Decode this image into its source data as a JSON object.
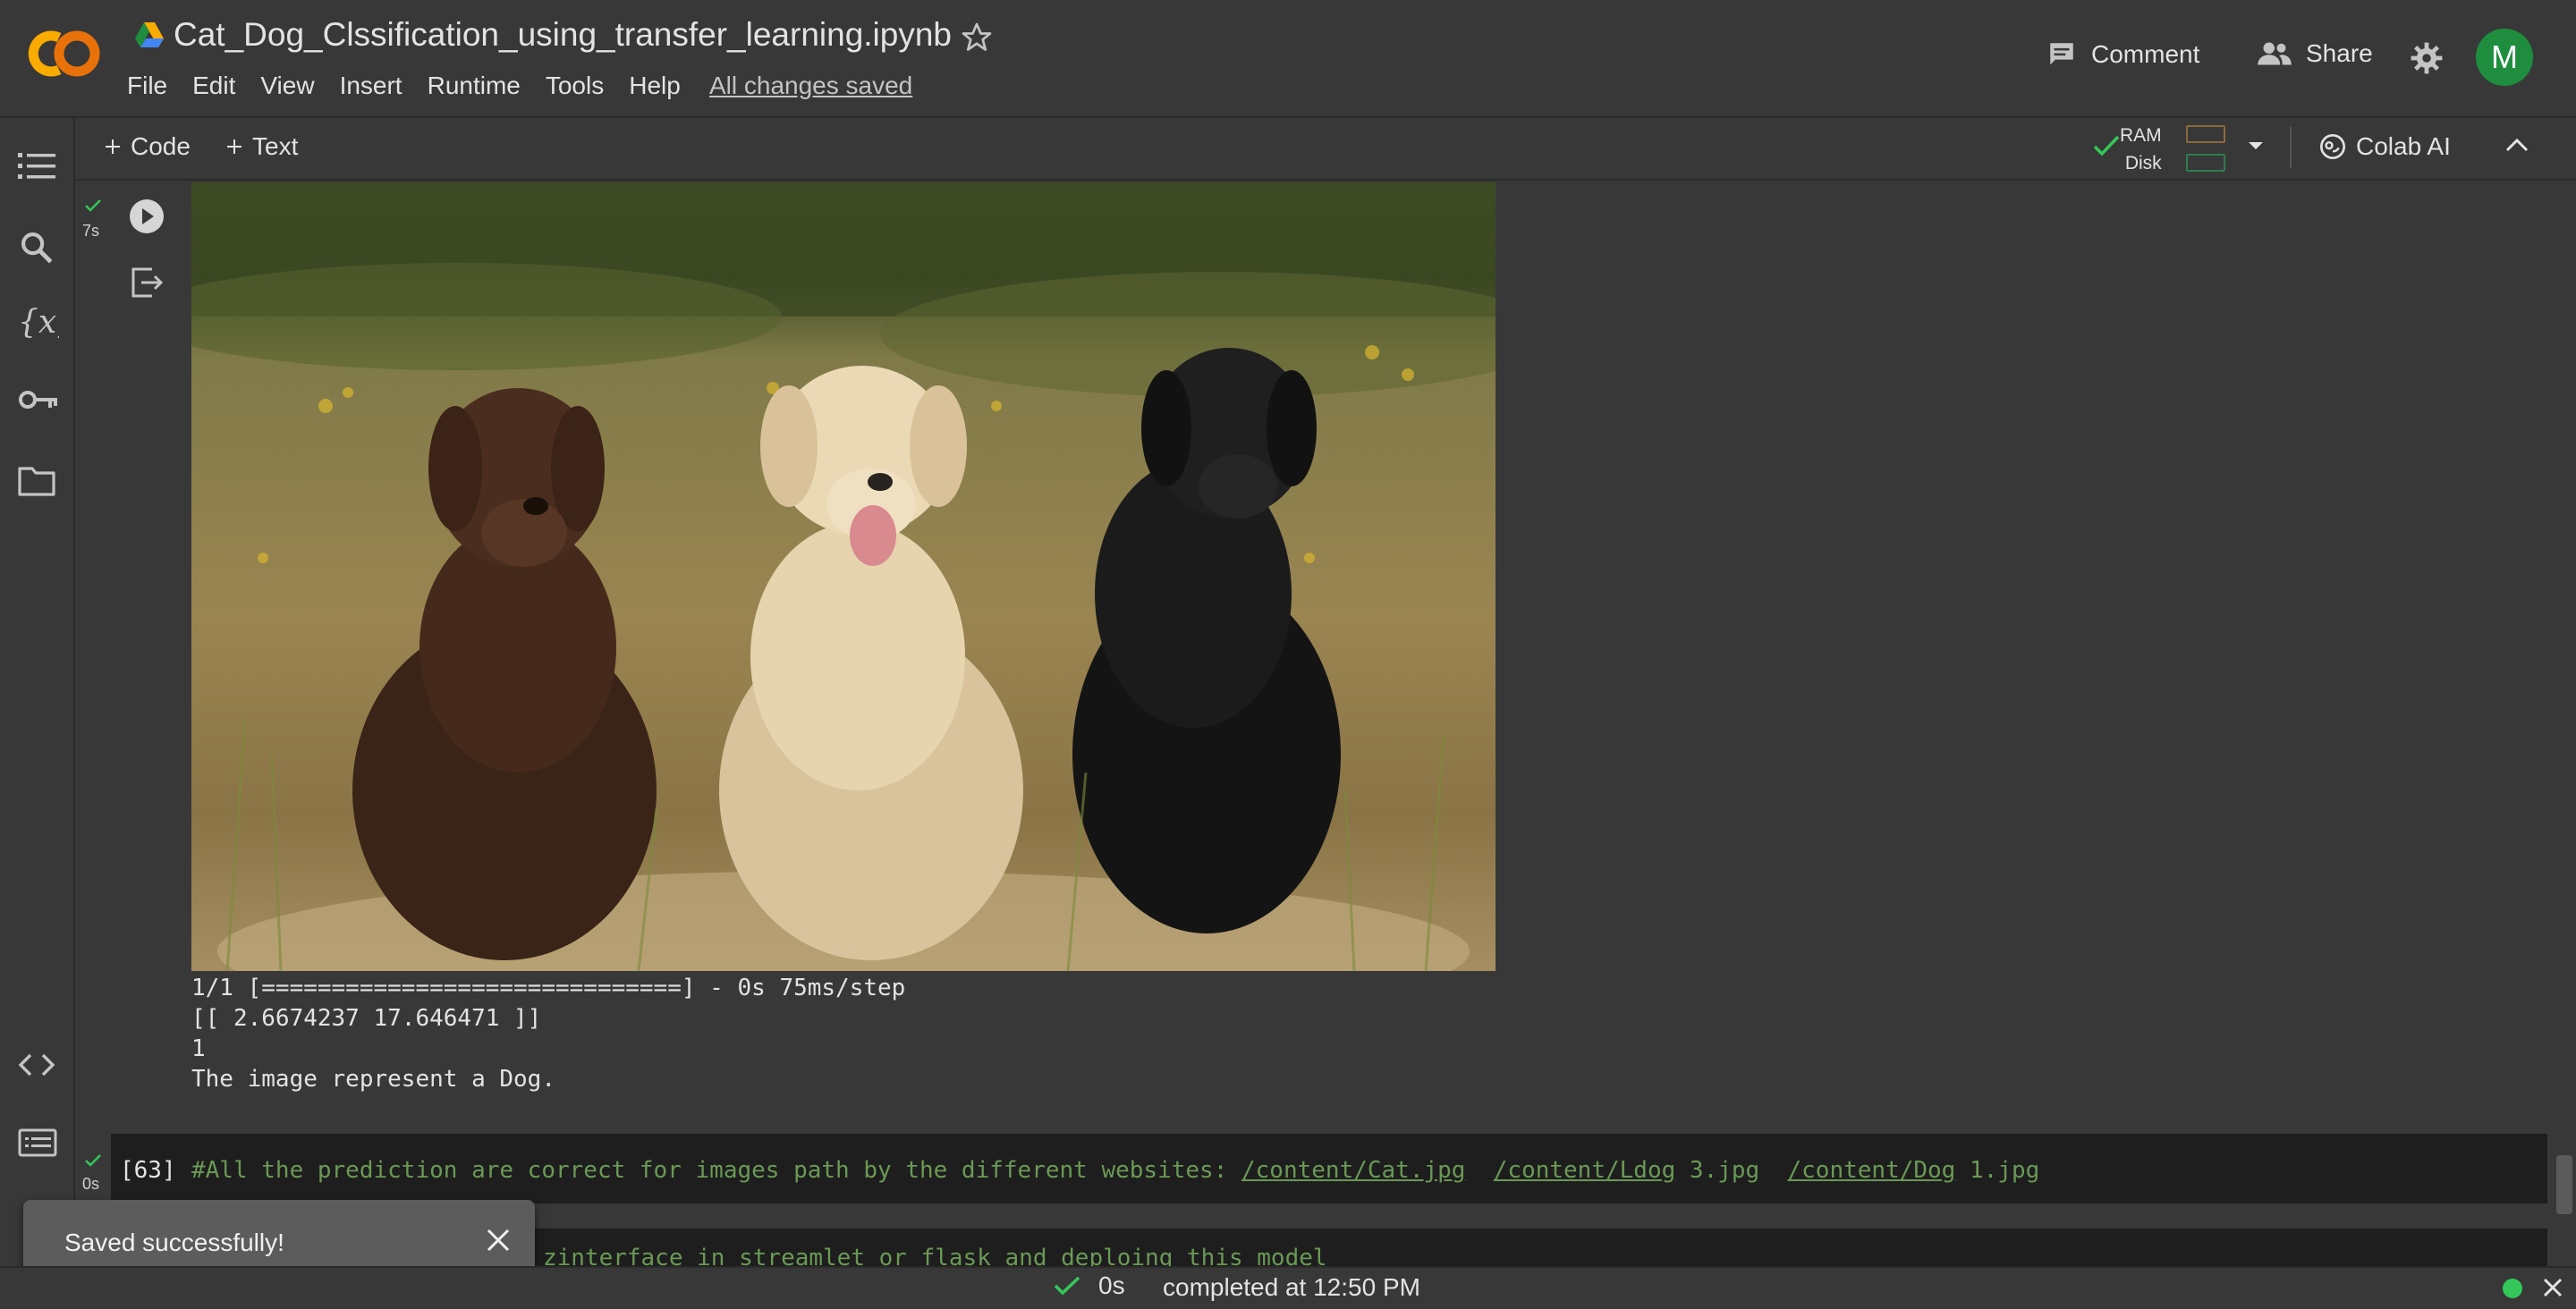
{
  "header": {
    "title": "Cat_Dog_Clssification_using_transfer_learning.ipynb",
    "menu": [
      "File",
      "Edit",
      "View",
      "Insert",
      "Runtime",
      "Tools",
      "Help"
    ],
    "save_status": "All changes saved",
    "comment_label": "Comment",
    "share_label": "Share",
    "avatar_letter": "M"
  },
  "toolbar": {
    "add_code": "Code",
    "add_text": "Text",
    "ram_label": "RAM",
    "disk_label": "Disk",
    "colab_ai_label": "Colab AI"
  },
  "cell_output": {
    "exec_time": "7s",
    "lines": [
      "1/1 [==============================] - 0s 75ms/step",
      "[[ 2.6674237 17.646471 ]]",
      "1",
      "The image represent a Dog."
    ]
  },
  "cell63": {
    "exec_time": "0s",
    "number": "[63]",
    "comment_prefix": "#All the prediction are correct for images path by the different websites: ",
    "link1": "/content/Cat.jpg",
    "link2a": "/content/Ldog",
    "link2b": " 3.jpg",
    "link3a": "/content/Dog",
    "link3b": " 1.jpg"
  },
  "cell64": {
    "partial_code": "er zinterface in streamlet or flask and deploing this model"
  },
  "toast": {
    "message": "Saved successfully!"
  },
  "status_bar": {
    "duration": "0s",
    "completed_text": "completed at 12:50 PM"
  },
  "colors": {
    "background": "#383838",
    "code_bg": "#1e1e1e",
    "comment_green": "#6a9955",
    "avatar_green": "#1e8e3e",
    "status_dot": "#34c759",
    "logo_orange": "#f9ab00"
  }
}
